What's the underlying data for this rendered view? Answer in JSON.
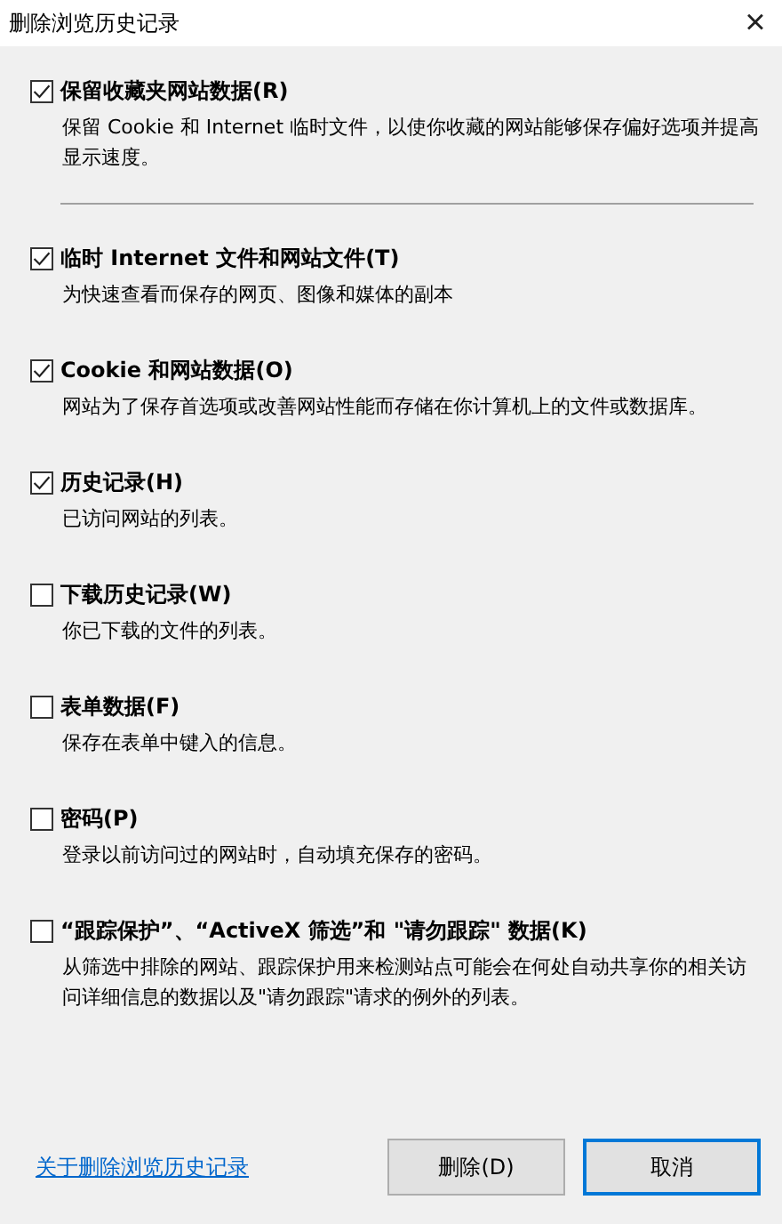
{
  "window": {
    "title": "删除浏览历史记录",
    "close": "×"
  },
  "sections": [
    {
      "options": [
        {
          "label": "保留收藏夹网站数据(R)",
          "checked": true,
          "description": "保留 Cookie 和 Internet 临时文件，以使你收藏的网站能够保存偏好选项并提高显示速度。"
        }
      ]
    },
    {
      "options": [
        {
          "label": "临时 Internet 文件和网站文件(T)",
          "checked": true,
          "description": "为快速查看而保存的网页、图像和媒体的副本"
        },
        {
          "label": "Cookie 和网站数据(O)",
          "checked": true,
          "description": "网站为了保存首选项或改善网站性能而存储在你计算机上的文件或数据库。"
        },
        {
          "label": "历史记录(H)",
          "checked": true,
          "description": "已访问网站的列表。"
        },
        {
          "label": "下载历史记录(W)",
          "checked": false,
          "description": "你已下载的文件的列表。"
        },
        {
          "label": "表单数据(F)",
          "checked": false,
          "description": "保存在表单中键入的信息。"
        },
        {
          "label": "密码(P)",
          "checked": false,
          "description": "登录以前访问过的网站时，自动填充保存的密码。"
        },
        {
          "label": "“跟踪保护”、“ActiveX 筛选”和 \"请勿跟踪\" 数据(K)",
          "checked": false,
          "description": "从筛选中排除的网站、跟踪保护用来检测站点可能会在何处自动共享你的相关访问详细信息的数据以及\"请勿跟踪\"请求的例外的列表。"
        }
      ]
    }
  ],
  "footer": {
    "link": "关于删除浏览历史记录",
    "buttons": [
      {
        "label": "删除(D)",
        "focused": false
      },
      {
        "label": "取消",
        "focused": true
      }
    ]
  }
}
